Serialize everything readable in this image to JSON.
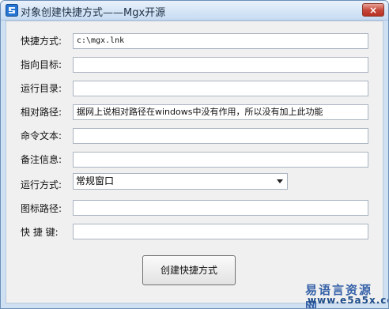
{
  "window": {
    "title": "对象创建快捷方式——Mgx开源",
    "app_icon": "blue-square-logo-icon",
    "close_icon": "close-icon",
    "close_symbol": "×",
    "colors": {
      "titlebar": "#c7dcf2",
      "close": "#c6483a",
      "client": "#f0f0f0"
    }
  },
  "form": {
    "fields": [
      {
        "label": "快捷方式:",
        "value": "c:\\mgx.lnk"
      },
      {
        "label": "指向目标:",
        "value": ""
      },
      {
        "label": "运行目录:",
        "value": ""
      },
      {
        "label": "相对路径:",
        "value": "据网上说相对路径在windows中没有作用，所以没有加上此功能"
      },
      {
        "label": "命令文本:",
        "value": ""
      },
      {
        "label": "备注信息:",
        "value": ""
      }
    ],
    "run_mode": {
      "label": "运行方式:",
      "selected": "常规窗口"
    },
    "extra_fields": [
      {
        "label": "图标路径:",
        "value": ""
      },
      {
        "label": "快 捷 键:",
        "value": ""
      }
    ],
    "create_button": "创建快捷方式"
  },
  "watermark": {
    "text": "易语言资源网",
    "url": "www.e5a5x.com"
  }
}
